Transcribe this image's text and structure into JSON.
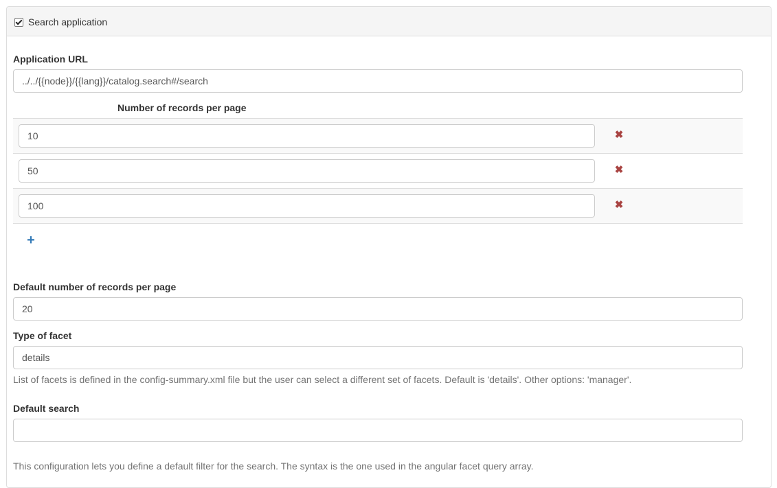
{
  "panel": {
    "checkbox_checked": true,
    "title": "Search application"
  },
  "app_url": {
    "label": "Application URL",
    "value": "../../{{node}}/{{lang}}/catalog.search#/search"
  },
  "records_table": {
    "header": "Number of records per page",
    "rows": [
      {
        "value": "10",
        "remove_icon": "times-icon"
      },
      {
        "value": "50",
        "remove_icon": "times-icon"
      },
      {
        "value": "100",
        "remove_icon": "times-icon"
      }
    ],
    "add_icon": "plus-icon",
    "add_symbol": "+",
    "remove_symbol": "✖"
  },
  "default_records": {
    "label": "Default number of records per page",
    "value": "20"
  },
  "facet_type": {
    "label": "Type of facet",
    "value": "details",
    "help": "List of facets is defined in the config-summary.xml file but the user can select a different set of facets. Default is 'details'. Other options: 'manager'."
  },
  "default_search": {
    "label": "Default search",
    "value": "",
    "help": "This configuration lets you define a default filter for the search. The syntax is the one used in the angular facet query array."
  },
  "colors": {
    "remove": "#a94442",
    "add": "#337ab7",
    "heading_bg": "#f5f5f5"
  }
}
